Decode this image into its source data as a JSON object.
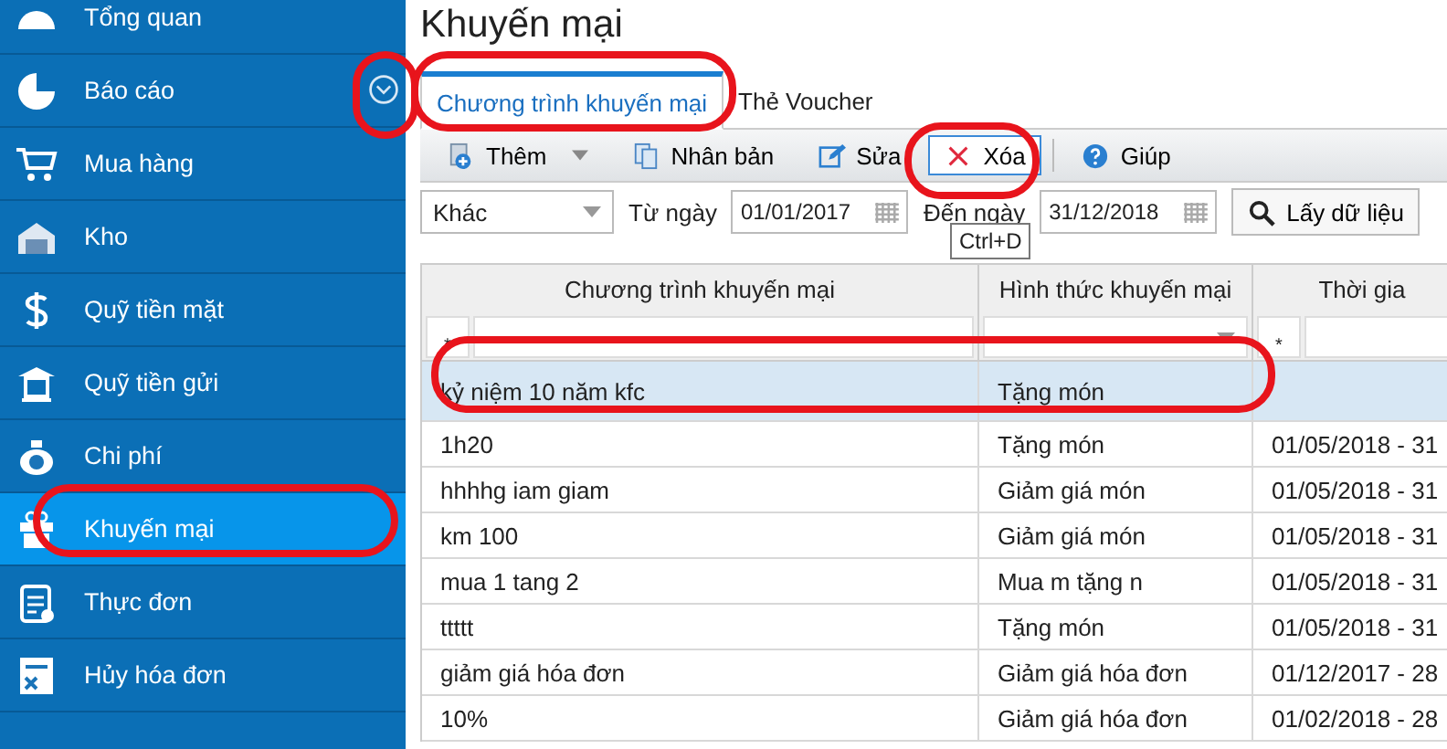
{
  "sidebar": {
    "items": [
      {
        "label": "Tổng quan",
        "selected": false
      },
      {
        "label": "Báo cáo",
        "selected": false
      },
      {
        "label": "Mua hàng",
        "selected": false
      },
      {
        "label": "Kho",
        "selected": false
      },
      {
        "label": "Quỹ tiền mặt",
        "selected": false
      },
      {
        "label": "Quỹ tiền gửi",
        "selected": false
      },
      {
        "label": "Chi phí",
        "selected": false
      },
      {
        "label": "Khuyến mại",
        "selected": true
      },
      {
        "label": "Thực đơn",
        "selected": false
      },
      {
        "label": "Hủy hóa đơn",
        "selected": false
      }
    ]
  },
  "page_title": "Khuyến mại",
  "tabs": [
    {
      "label": "Chương trình khuyến mại",
      "selected": true
    },
    {
      "label": "Thẻ Voucher",
      "selected": false
    }
  ],
  "toolbar": [
    {
      "kind": "add",
      "label": "Thêm",
      "focused": false
    },
    {
      "kind": "duplicate",
      "label": "Nhân bản",
      "focused": false
    },
    {
      "kind": "edit",
      "label": "Sửa",
      "focused": false
    },
    {
      "kind": "delete",
      "label": "Xóa",
      "focused": true
    },
    {
      "kind": "help",
      "label": "Giúp",
      "focused": false
    }
  ],
  "filter": {
    "period": "Khác",
    "from_label": "Từ ngày",
    "from_value": "01/01/2017",
    "to_label": "Đến ngày",
    "to_value": "31/12/2018",
    "fetch_button": "Lấy dữ liệu"
  },
  "tooltip": "Ctrl+D",
  "table": {
    "columns": [
      "Chương trình khuyến mại",
      "Hình thức khuyến mại",
      "Thời gia"
    ],
    "filter_row": [
      {
        "kind": "text",
        "operator": "*"
      },
      {
        "kind": "select"
      },
      {
        "kind": "text",
        "operator": "*"
      }
    ],
    "rows": [
      {
        "cells": [
          "kỷ niệm 10 năm kfc",
          "Tặng món",
          ""
        ],
        "selected": true
      },
      {
        "cells": [
          "1h20",
          "Tặng món",
          "01/05/2018 - 31"
        ],
        "selected": false
      },
      {
        "cells": [
          "hhhhg iam giam",
          "Giảm giá món",
          "01/05/2018 - 31"
        ],
        "selected": false
      },
      {
        "cells": [
          "km 100",
          "Giảm giá món",
          "01/05/2018 - 31"
        ],
        "selected": false
      },
      {
        "cells": [
          "mua 1 tang 2",
          "Mua m tặng n",
          "01/05/2018 - 31"
        ],
        "selected": false
      },
      {
        "cells": [
          "ttttt",
          "Tặng món",
          "01/05/2018 - 31"
        ],
        "selected": false
      },
      {
        "cells": [
          "giảm giá hóa đơn",
          "Giảm giá hóa đơn",
          "01/12/2017 - 28"
        ],
        "selected": false
      },
      {
        "cells": [
          "10%",
          "Giảm giá hóa đơn",
          "01/02/2018 - 28"
        ],
        "selected": false
      }
    ]
  }
}
